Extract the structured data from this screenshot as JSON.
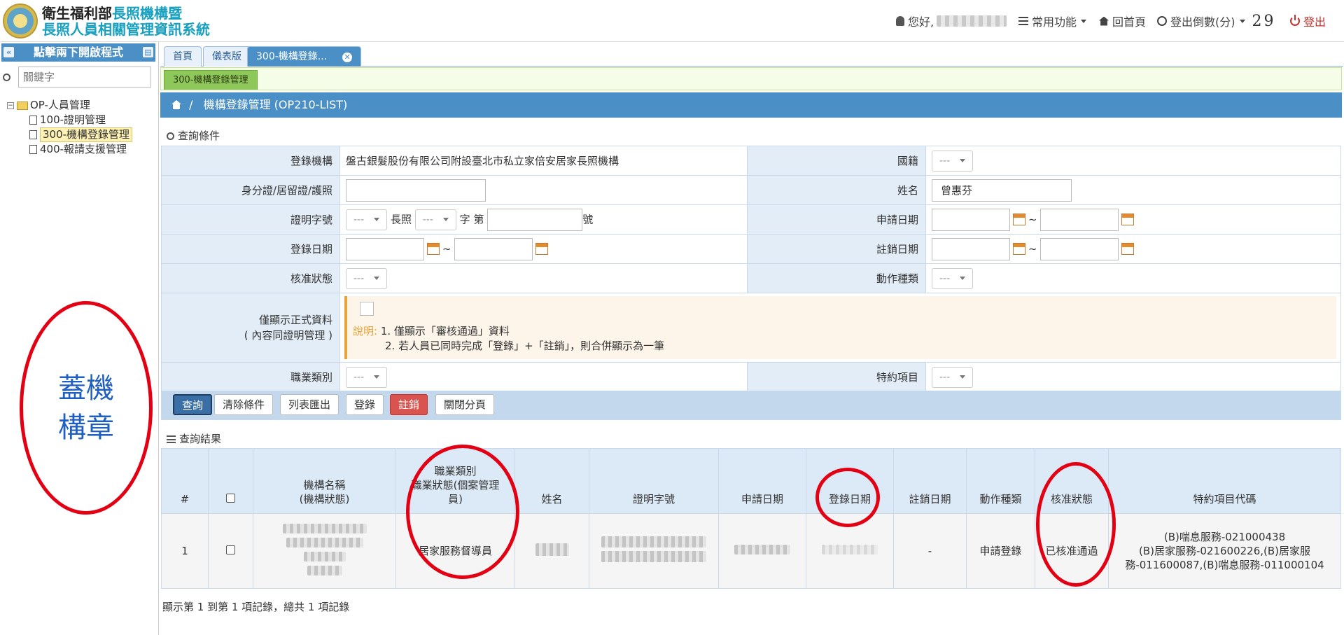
{
  "header": {
    "title_line1_a": "衛生福利部",
    "title_line1_b": "長照機構暨",
    "title_line2": "長照人員相關管理資訊系統",
    "greeting": "您好,",
    "common_functions": "常用功能",
    "home": "回首頁",
    "logout_countdown_label": "登出倒數(分)",
    "logout_countdown_value": "29",
    "logout": "登出"
  },
  "sidebar": {
    "header": "點擊兩下開啟程式",
    "search_placeholder": "關鍵字",
    "root": "OP-人員管理",
    "items": [
      {
        "label": "100-證明管理"
      },
      {
        "label": "300-機構登錄管理"
      },
      {
        "label": "400-報請支援管理"
      }
    ],
    "stamp_text": "蓋機構章"
  },
  "tabs": [
    {
      "label": "首頁"
    },
    {
      "label": "儀表版"
    },
    {
      "label": "300-機構登錄..."
    }
  ],
  "subtab": "300-機構登錄管理",
  "breadcrumb": "機構登錄管理 (OP210-LIST)",
  "query": {
    "section_title": "查詢條件",
    "fields": {
      "org_label": "登錄機構",
      "org_value": "盤古銀髮股份有限公司附設臺北市私立家倍安居家長照機構",
      "nationality_label": "國籍",
      "id_label": "身分證/居留證/護照",
      "name_label": "姓名",
      "name_value": "曾惠芬",
      "cert_label": "證明字號",
      "cert_long_care": "長照",
      "cert_word": "字 第",
      "cert_number": "號",
      "apply_date_label": "申請日期",
      "register_date_label": "登錄日期",
      "cancel_date_label": "註銷日期",
      "approval_label": "核准狀態",
      "action_label": "動作種類",
      "formal_only_label_1": "僅顯示正式資料",
      "formal_only_label_2": "( 內容同證明管理 )",
      "note_head": "說明:",
      "note_1": "1. 僅顯示「審核通過」資料",
      "note_2": "2. 若人員已同時完成「登錄」+「註銷」，則合併顯示為一筆",
      "job_label": "職業類別",
      "special_label": "特約項目",
      "select_placeholder": "---",
      "tilde": "~"
    },
    "buttons": {
      "search": "查詢",
      "clear": "清除條件",
      "export": "列表匯出",
      "register": "登錄",
      "cancel": "註銷",
      "close_tab": "關閉分頁"
    }
  },
  "results": {
    "section_title": "查詢結果",
    "columns": {
      "index": "#",
      "org_1": "機構名稱",
      "org_2": "(機構狀態)",
      "job_1": "職業類別",
      "job_2": "職業狀態(個案管理",
      "job_3": "員)",
      "name": "姓名",
      "cert": "證明字號",
      "apply_date": "申請日期",
      "register_date": "登錄日期",
      "cancel_date": "註銷日期",
      "action": "動作種類",
      "approval": "核准狀態",
      "special": "特約項目代碼"
    },
    "rows": [
      {
        "index": "1",
        "job": "居家服務督導員",
        "cancel_date": "-",
        "action": "申請登錄",
        "approval": "已核准通過",
        "special_1": "(B)喘息服務-021000438",
        "special_2": "(B)居家服務-021600226,(B)居家服",
        "special_3": "務-011600087,(B)喘息服務-011000104"
      }
    ],
    "footer": "顯示第 1 到第 1 項記錄，總共 1 項記錄"
  },
  "colors": {
    "accent_blue": "#4b8fc7",
    "annotation_red": "#e30013",
    "danger": "#d9534f"
  }
}
